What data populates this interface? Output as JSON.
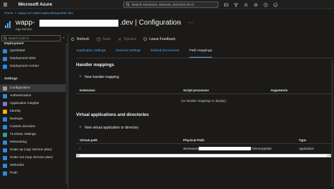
{
  "topbar": {
    "brand": "Microsoft Azure",
    "search_placeholder": "Search resources, services, and docs (G+/)"
  },
  "breadcrumb": {
    "home": "Home",
    "resource": "wapp-crm-sales-sapcostrequester-dev"
  },
  "header": {
    "title_prefix": "wapp-",
    "title_suffix": ".dev | Configuration",
    "subtitle": "App Service",
    "pin_glyph": "☆",
    "more_glyph": "···"
  },
  "sidebar": {
    "search_placeholder": "Search (Ctrl+/)",
    "collapse_glyph": "«",
    "partial_top": "Deployment",
    "items_top": [
      {
        "label": "Quickstart",
        "icon": "cloud-icon",
        "color": "#2a8be0"
      },
      {
        "label": "Deployment slots",
        "icon": "slots-icon",
        "color": "#2a8be0"
      },
      {
        "label": "Deployment Center",
        "icon": "deployment-center-icon",
        "color": "#2a8be0"
      }
    ],
    "settings_heading": "Settings",
    "items_settings": [
      {
        "label": "Configuration",
        "icon": "configuration-icon",
        "color": "#9c9c9c",
        "active": true
      },
      {
        "label": "Authentication",
        "icon": "authentication-icon",
        "color": "#2a8be0"
      },
      {
        "label": "Application Insights",
        "icon": "insights-icon",
        "color": "#8c6fd6"
      },
      {
        "label": "Identity",
        "icon": "identity-icon",
        "color": "#e8b600"
      },
      {
        "label": "Backups",
        "icon": "backups-icon",
        "color": "#2a8be0"
      },
      {
        "label": "Custom domains",
        "icon": "domains-icon",
        "color": "#2a8be0"
      },
      {
        "label": "TLS/SSL settings",
        "icon": "shield-icon",
        "color": "#2ca58d"
      },
      {
        "label": "Networking",
        "icon": "networking-icon",
        "color": "#2a8be0"
      },
      {
        "label": "Scale up (App Service plan)",
        "icon": "scale-up-icon",
        "color": "#2a8be0"
      },
      {
        "label": "Scale out (App Service plan)",
        "icon": "scale-out-icon",
        "color": "#2a8be0"
      },
      {
        "label": "WebJobs",
        "icon": "webjobs-icon",
        "color": "#2a8be0"
      },
      {
        "label": "Push",
        "icon": "push-icon",
        "color": "#2a8be0"
      }
    ]
  },
  "commands": {
    "refresh": "Refresh",
    "save": "Save",
    "discard": "Discard",
    "feedback": "Leave Feedback"
  },
  "tabs": [
    {
      "label": "Application settings",
      "active": false
    },
    {
      "label": "General settings",
      "active": false
    },
    {
      "label": "Default documents",
      "active": false
    },
    {
      "label": "Path mappings",
      "active": true
    }
  ],
  "handler": {
    "title": "Handler mappings",
    "add_label": "New handler mapping",
    "columns": [
      "Extension",
      "Script processor",
      "Arguments"
    ],
    "empty_message": "(no handler mappings to display)"
  },
  "virtual": {
    "title": "Virtual applications and directories",
    "add_label": "New virtual application or directory",
    "columns": [
      "Virtual path",
      "Physical Path",
      "Type"
    ],
    "rows": [
      {
        "virtual_path": "/",
        "physical_prefix": "site\\wwwroot\\",
        "physical_suffix": "\\ClientApp\\dist",
        "type": "Application"
      }
    ]
  },
  "colors": {
    "accent": "#4ea8f0",
    "background": "#1b1a19",
    "topbar": "#1f1f1f"
  }
}
